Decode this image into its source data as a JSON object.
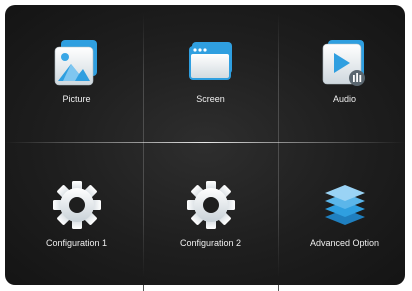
{
  "menu": {
    "tiles": [
      {
        "label": "Picture",
        "icon": "picture-icon"
      },
      {
        "label": "Screen",
        "icon": "screen-icon"
      },
      {
        "label": "Audio",
        "icon": "audio-icon"
      },
      {
        "label": "Configuration 1",
        "icon": "gear-icon"
      },
      {
        "label": "Configuration 2",
        "icon": "gear-icon"
      },
      {
        "label": "Advanced Option",
        "icon": "layers-icon"
      }
    ]
  },
  "colors": {
    "background": "#1e1e1e",
    "label_text": "#f0f0f0",
    "icon_blue": "#2f9fe0",
    "icon_light_blue": "#7fc6f0",
    "gear_fill": "#e8ecef"
  }
}
